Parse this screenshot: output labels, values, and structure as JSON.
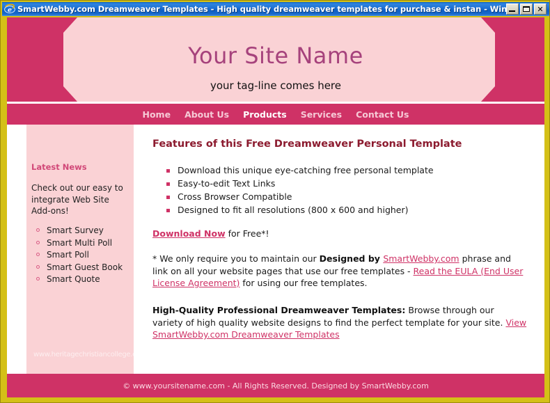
{
  "window": {
    "title": "SmartWebby.com Dreamweaver Templates - High quality dreamweaver templates for purchase & instan - Windows Interne...",
    "icon": "internet-explorer-icon",
    "controls": {
      "minimize": "_",
      "maximize": "□",
      "close": "✕"
    }
  },
  "header": {
    "site_name": "Your Site Name",
    "tagline": "your tag-line comes here"
  },
  "nav": {
    "items": [
      {
        "label": "Home",
        "active": false
      },
      {
        "label": "About Us",
        "active": false
      },
      {
        "label": "Products",
        "active": true
      },
      {
        "label": "Services",
        "active": false
      },
      {
        "label": "Contact Us",
        "active": false
      }
    ]
  },
  "sidebar": {
    "title": "Latest News",
    "text": "Check out our easy to integrate Web Site Add-ons!",
    "links": [
      "Smart Survey",
      "Smart Multi Poll",
      "Smart Poll",
      "Smart Guest Book",
      "Smart Quote"
    ],
    "watermark": "www.heritagechristiancollege.com"
  },
  "main": {
    "heading": "Features of this Free Dreamweaver Personal Template",
    "features": [
      "Download this unique eye-catching free personal template",
      "Easy-to-edit Text Links",
      "Cross Browser Compatible",
      "Designed to fit all resolutions (800 x 600 and higher)"
    ],
    "download": {
      "link": "Download Now",
      "suffix": " for Free*!"
    },
    "eula": {
      "pre": "* We only require you to maintain our ",
      "bold": "Designed by ",
      "link1": "SmartWebby.com",
      "mid": " phrase and link on all your website pages that use our free templates - ",
      "link2": "Read the EULA (End User License Agreement)",
      "post": " for using our free templates."
    },
    "promo": {
      "bold": "High-Quality Professional Dreamweaver Templates:",
      "text": " Browse through our variety of high quality website designs to find the perfect template for your site. ",
      "link": "View SmartWebby.com Dreamweaver Templates"
    }
  },
  "footer": {
    "text": "© www.yoursitename.com - All Rights Reserved. Designed by SmartWebby.com"
  },
  "colors": {
    "brand_pink": "#cf3266",
    "light_pink": "#fad2d5",
    "heading_maroon": "#8c1b2f",
    "site_name_purple": "#a6427c",
    "window_border": "#d4c017"
  }
}
